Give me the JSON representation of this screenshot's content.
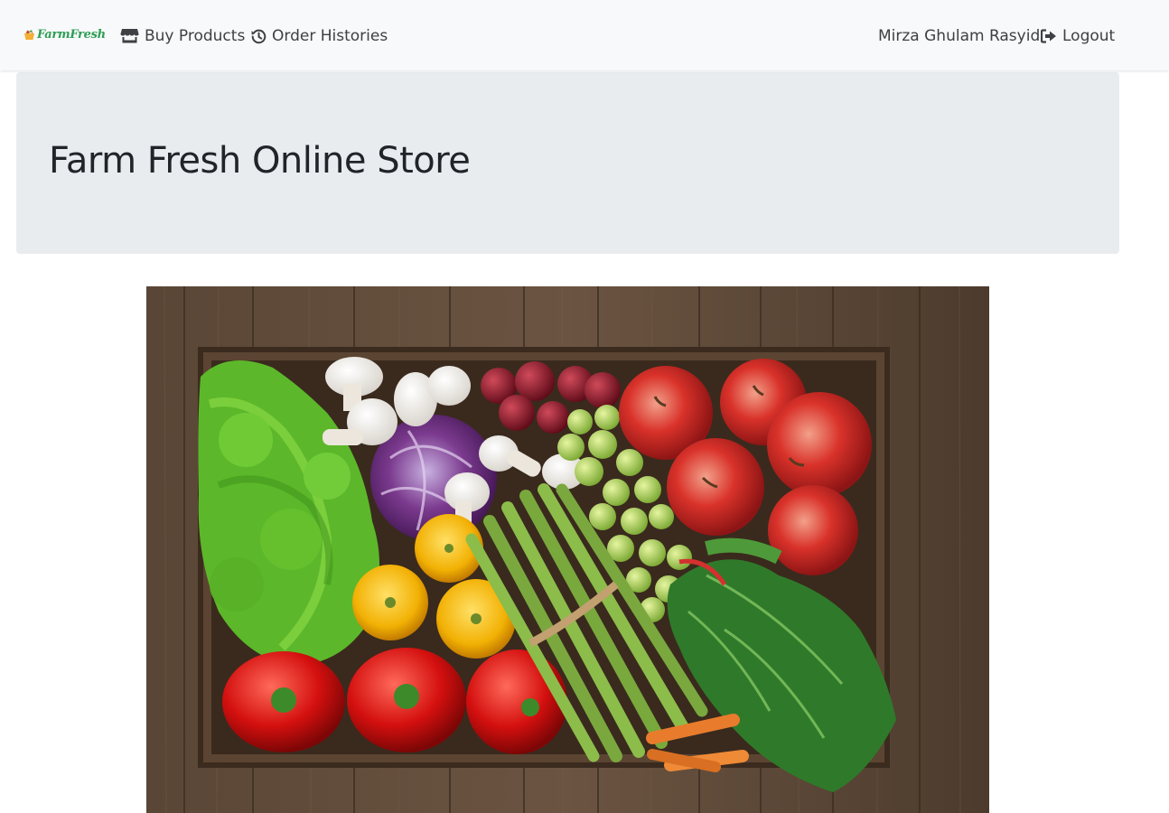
{
  "navbar": {
    "brand": {
      "farm": "Farm",
      "fresh": "Fresh"
    },
    "links": {
      "buy_products": "Buy Products",
      "order_histories": "Order Histories"
    },
    "user_name": "Mirza Ghulam Rasyid",
    "logout": "Logout",
    "icons": {
      "buy_products": "store-icon",
      "order_histories": "history-icon",
      "logout": "sign-out-icon"
    }
  },
  "jumbotron": {
    "title": "Farm Fresh Online Store"
  },
  "hero": {
    "image": "produce-crate-photo"
  },
  "colors": {
    "navbar_bg": "#f8f9fa",
    "jumbotron_bg": "#e9ecef",
    "brand_green": "#2e9e55",
    "text": "#212529"
  }
}
